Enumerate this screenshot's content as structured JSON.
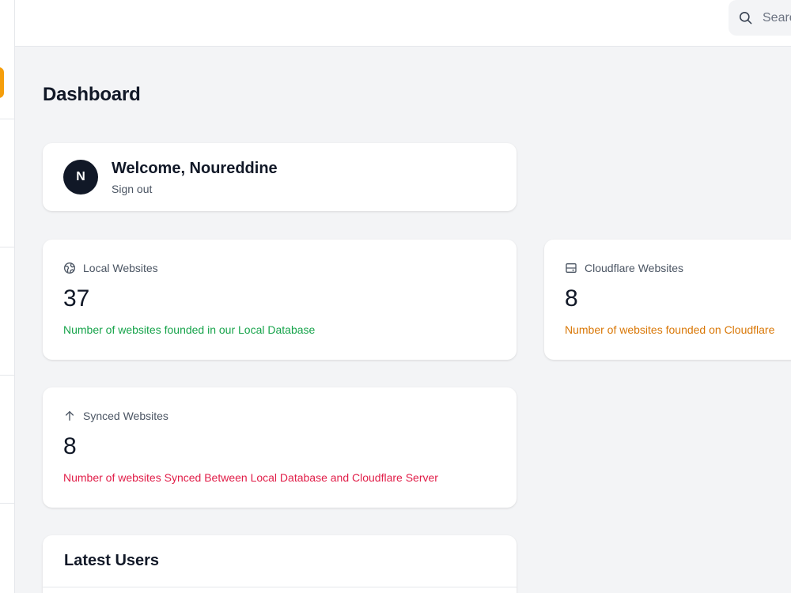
{
  "header": {
    "search": {
      "placeholder": "Search",
      "icon": "search-icon"
    }
  },
  "page": {
    "title": "Dashboard"
  },
  "welcome": {
    "avatar_initial": "N",
    "greeting": "Welcome, Noureddine",
    "signout_label": "Sign out"
  },
  "stats": {
    "local": {
      "icon": "globe-icon",
      "label": "Local Websites",
      "value": "37",
      "description": "Number of websites founded in our Local Database",
      "color": "#16a34a"
    },
    "cloudflare": {
      "icon": "server-icon",
      "label": "Cloudflare Websites",
      "value": "8",
      "description": "Number of websites founded on Cloudflare",
      "color": "#d97706"
    },
    "synced": {
      "icon": "arrow-up-icon",
      "label": "Synced Websites",
      "value": "8",
      "description": "Number of websites Synced Between Local Database and Cloudflare Server",
      "color": "#e11d48"
    }
  },
  "latest_users": {
    "title": "Latest Users"
  },
  "colors": {
    "accent": "#f59e0b",
    "background": "#f3f4f6",
    "avatar_bg": "#111827"
  }
}
